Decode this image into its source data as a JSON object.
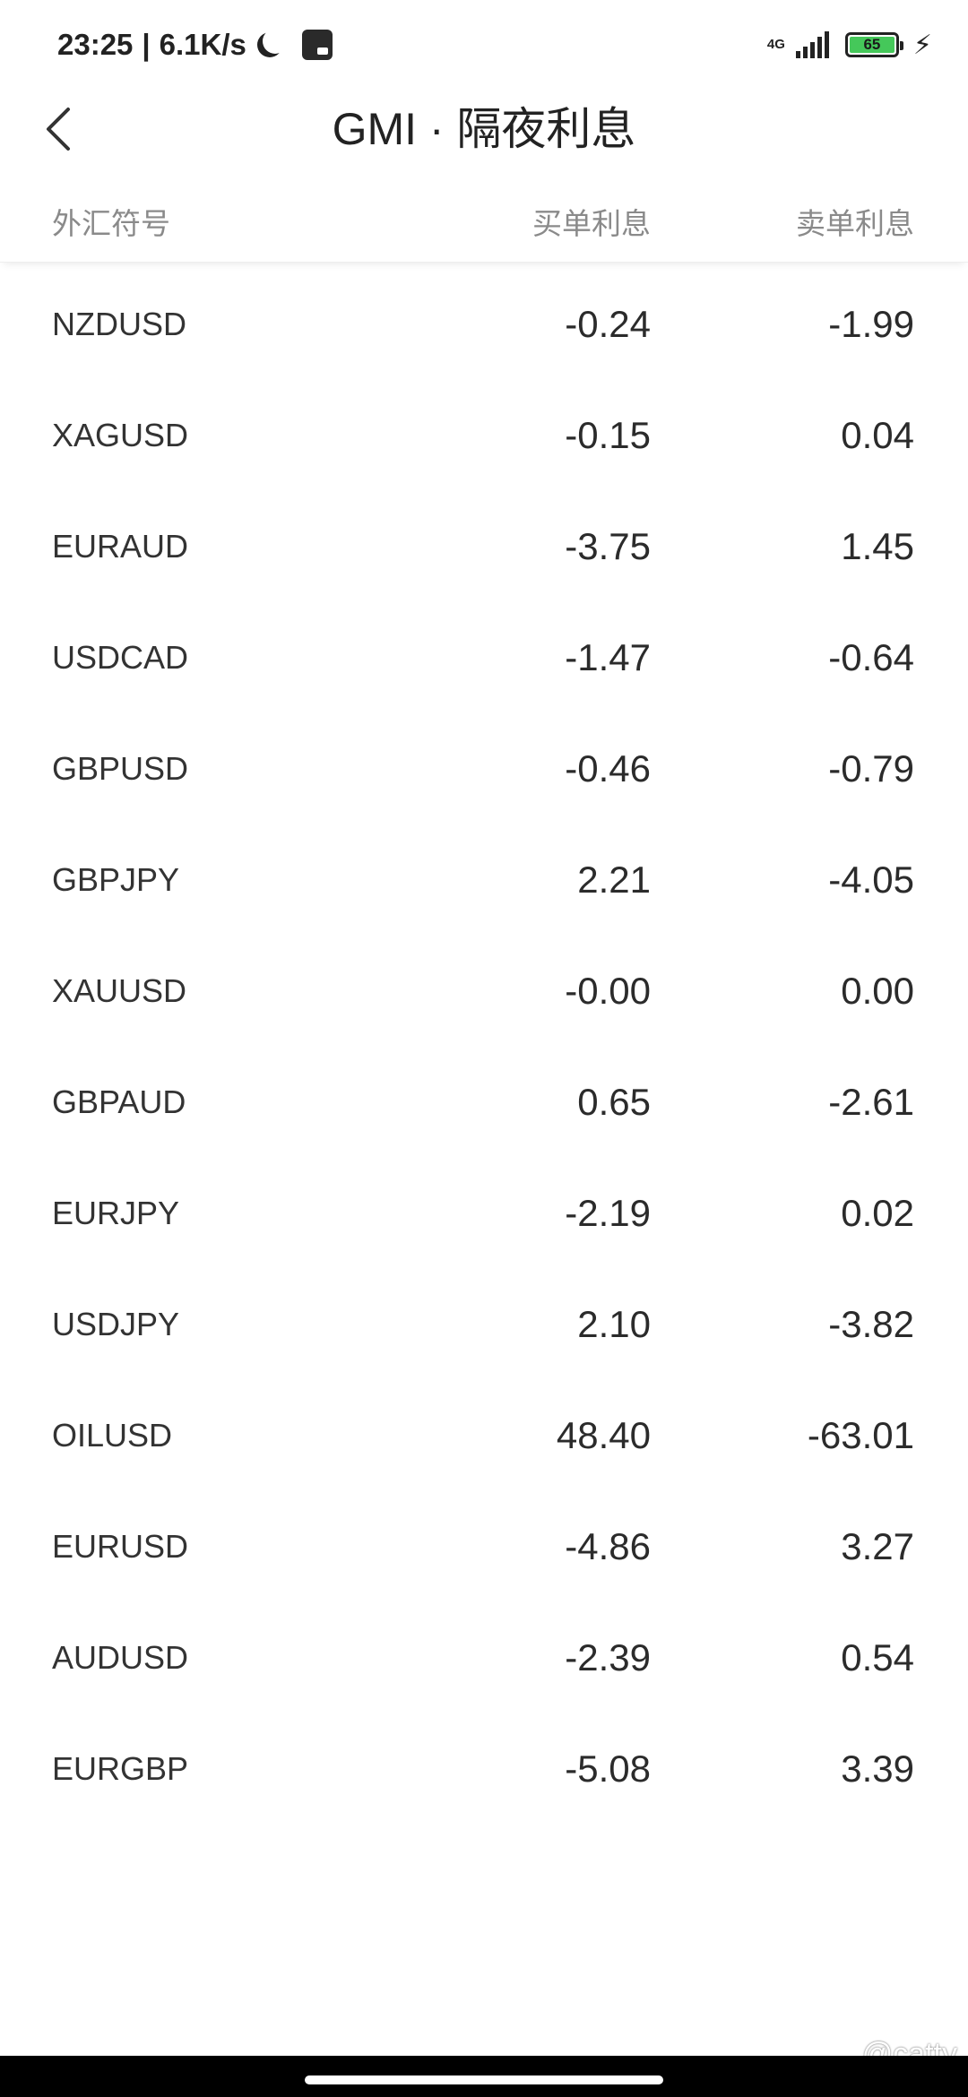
{
  "status_bar": {
    "time": "23:25",
    "net_speed": "6.1K/s",
    "network_type": "4G",
    "battery_level": "65",
    "battery_color": "#45c85a"
  },
  "header": {
    "title": "GMI · 隔夜利息"
  },
  "table": {
    "headers": {
      "symbol": "外汇符号",
      "buy": "买单利息",
      "sell": "卖单利息"
    },
    "rows": [
      {
        "symbol": "NZDUSD",
        "buy": "-0.24",
        "sell": "-1.99"
      },
      {
        "symbol": "XAGUSD",
        "buy": "-0.15",
        "sell": "0.04"
      },
      {
        "symbol": "EURAUD",
        "buy": "-3.75",
        "sell": "1.45"
      },
      {
        "symbol": "USDCAD",
        "buy": "-1.47",
        "sell": "-0.64"
      },
      {
        "symbol": "GBPUSD",
        "buy": "-0.46",
        "sell": "-0.79"
      },
      {
        "symbol": "GBPJPY",
        "buy": "2.21",
        "sell": "-4.05"
      },
      {
        "symbol": "XAUUSD",
        "buy": "-0.00",
        "sell": "0.00"
      },
      {
        "symbol": "GBPAUD",
        "buy": "0.65",
        "sell": "-2.61"
      },
      {
        "symbol": "EURJPY",
        "buy": "-2.19",
        "sell": "0.02"
      },
      {
        "symbol": "USDJPY",
        "buy": "2.10",
        "sell": "-3.82"
      },
      {
        "symbol": "OILUSD",
        "buy": "48.40",
        "sell": "-63.01"
      },
      {
        "symbol": "EURUSD",
        "buy": "-4.86",
        "sell": "3.27"
      },
      {
        "symbol": "AUDUSD",
        "buy": "-2.39",
        "sell": "0.54"
      },
      {
        "symbol": "EURGBP",
        "buy": "-5.08",
        "sell": "3.39"
      }
    ]
  },
  "watermark": "@catty"
}
